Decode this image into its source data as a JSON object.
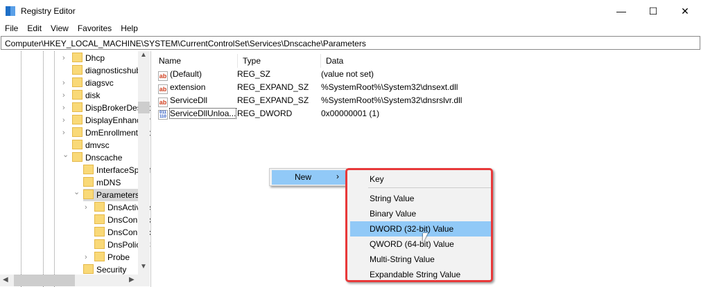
{
  "window": {
    "title": "Registry Editor",
    "minimize": "—",
    "maximize": "☐",
    "close": "✕"
  },
  "menu": [
    "File",
    "Edit",
    "View",
    "Favorites",
    "Help"
  ],
  "address": "Computer\\HKEY_LOCAL_MACHINE\\SYSTEM\\CurrentControlSet\\Services\\Dnscache\\Parameters",
  "tree": [
    {
      "label": "Dhcp",
      "level": 0,
      "expander": "collapsed"
    },
    {
      "label": "diagnosticshub",
      "level": 0,
      "expander": "none"
    },
    {
      "label": "diagsvc",
      "level": 0,
      "expander": "collapsed"
    },
    {
      "label": "disk",
      "level": 0,
      "expander": "collapsed"
    },
    {
      "label": "DispBrokerDesktopSvc",
      "level": 0,
      "expander": "collapsed"
    },
    {
      "label": "DisplayEnhancementService",
      "level": 0,
      "expander": "collapsed"
    },
    {
      "label": "DmEnrollmentSvc",
      "level": 0,
      "expander": "collapsed"
    },
    {
      "label": "dmvsc",
      "level": 0,
      "expander": "none"
    },
    {
      "label": "Dnscache",
      "level": 0,
      "expander": "expanded"
    },
    {
      "label": "InterfaceSpecificParameters",
      "level": 1,
      "expander": "none"
    },
    {
      "label": "mDNS",
      "level": 1,
      "expander": "none"
    },
    {
      "label": "Parameters",
      "level": 1,
      "expander": "expanded",
      "selected": true
    },
    {
      "label": "DnsActiveIfs",
      "level": 2,
      "expander": "collapsed"
    },
    {
      "label": "DnsConnections",
      "level": 2,
      "expander": "none"
    },
    {
      "label": "DnsConnectionsProxies",
      "level": 2,
      "expander": "none"
    },
    {
      "label": "DnsPolicyConfig",
      "level": 2,
      "expander": "none"
    },
    {
      "label": "Probe",
      "level": 2,
      "expander": "collapsed"
    },
    {
      "label": "Security",
      "level": 1,
      "expander": "none"
    }
  ],
  "list": {
    "headers": [
      "Name",
      "Type",
      "Data"
    ],
    "rows": [
      {
        "icon": "string-value-icon",
        "name": "(Default)",
        "type": "REG_SZ",
        "data": "(value not set)"
      },
      {
        "icon": "string-value-icon",
        "name": "extension",
        "type": "REG_EXPAND_SZ",
        "data": "%SystemRoot%\\System32\\dnsext.dll"
      },
      {
        "icon": "string-value-icon",
        "name": "ServiceDll",
        "type": "REG_EXPAND_SZ",
        "data": "%SystemRoot%\\System32\\dnsrslvr.dll"
      },
      {
        "icon": "binary-value-icon",
        "name": "ServiceDllUnloa...",
        "type": "REG_DWORD",
        "data": "0x00000001 (1)"
      }
    ]
  },
  "context_menu": {
    "new_label": "New",
    "arrow": "›",
    "submenu": [
      "Key",
      "String Value",
      "Binary Value",
      "DWORD (32-bit) Value",
      "QWORD (64-bit) Value",
      "Multi-String Value",
      "Expandable String Value"
    ],
    "highlighted": "DWORD (32-bit) Value"
  },
  "colors": {
    "highlight": "#91c9f7",
    "annotation_border": "#e8393a",
    "folder": "#f9d978"
  },
  "icons": {
    "ab": "ab",
    "bin": "011\n110"
  }
}
